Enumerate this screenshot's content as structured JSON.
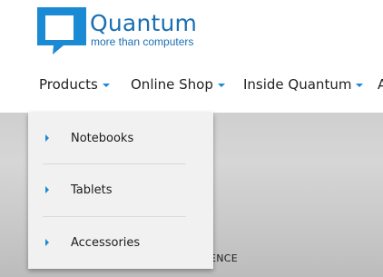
{
  "brand": {
    "name": "Quantum",
    "tagline": "more than computers",
    "accent_color": "#1a8ad4",
    "text_color": "#1a6fb4"
  },
  "nav": {
    "items": [
      {
        "label": "Products",
        "has_dropdown": true
      },
      {
        "label": "Online Shop",
        "has_dropdown": true
      },
      {
        "label": "Inside Quantum",
        "has_dropdown": true
      },
      {
        "label": "A",
        "has_dropdown": false
      }
    ]
  },
  "dropdown": {
    "parent": "Products",
    "items": [
      {
        "label": "Notebooks"
      },
      {
        "label": "Tablets"
      },
      {
        "label": "Accessories"
      }
    ]
  },
  "hero": {
    "partial_text": "ENCE"
  }
}
